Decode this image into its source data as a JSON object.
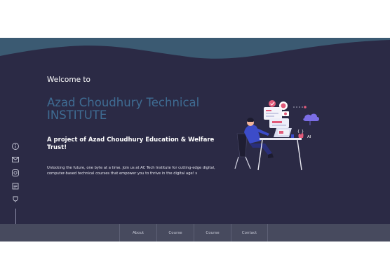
{
  "hero": {
    "welcome": "Welcome to",
    "title": "Azad Choudhury Technical INSTITUTE",
    "project": "A project of Azad Choudhury Education & Welfare Trust!",
    "description": "Unlocking the future, one byte at a time. Join us at AC Tech Institute for cutting-edge digital, computer-based technical courses that empower you to thrive in the digital age! s"
  },
  "social": {
    "icons": [
      "info-icon",
      "mail-icon",
      "instagram-icon",
      "document-icon",
      "trophy-icon"
    ]
  },
  "nav": {
    "items": [
      {
        "label": "About"
      },
      {
        "label": "Course"
      },
      {
        "label": "Course"
      },
      {
        "label": "Contact"
      }
    ]
  },
  "colors": {
    "hero_bg": "#2b2a45",
    "wave": "#3b5a72",
    "title": "#3f6c93",
    "nav_bg": "#474a5e"
  },
  "illustration": {
    "badge_text": "AI"
  }
}
